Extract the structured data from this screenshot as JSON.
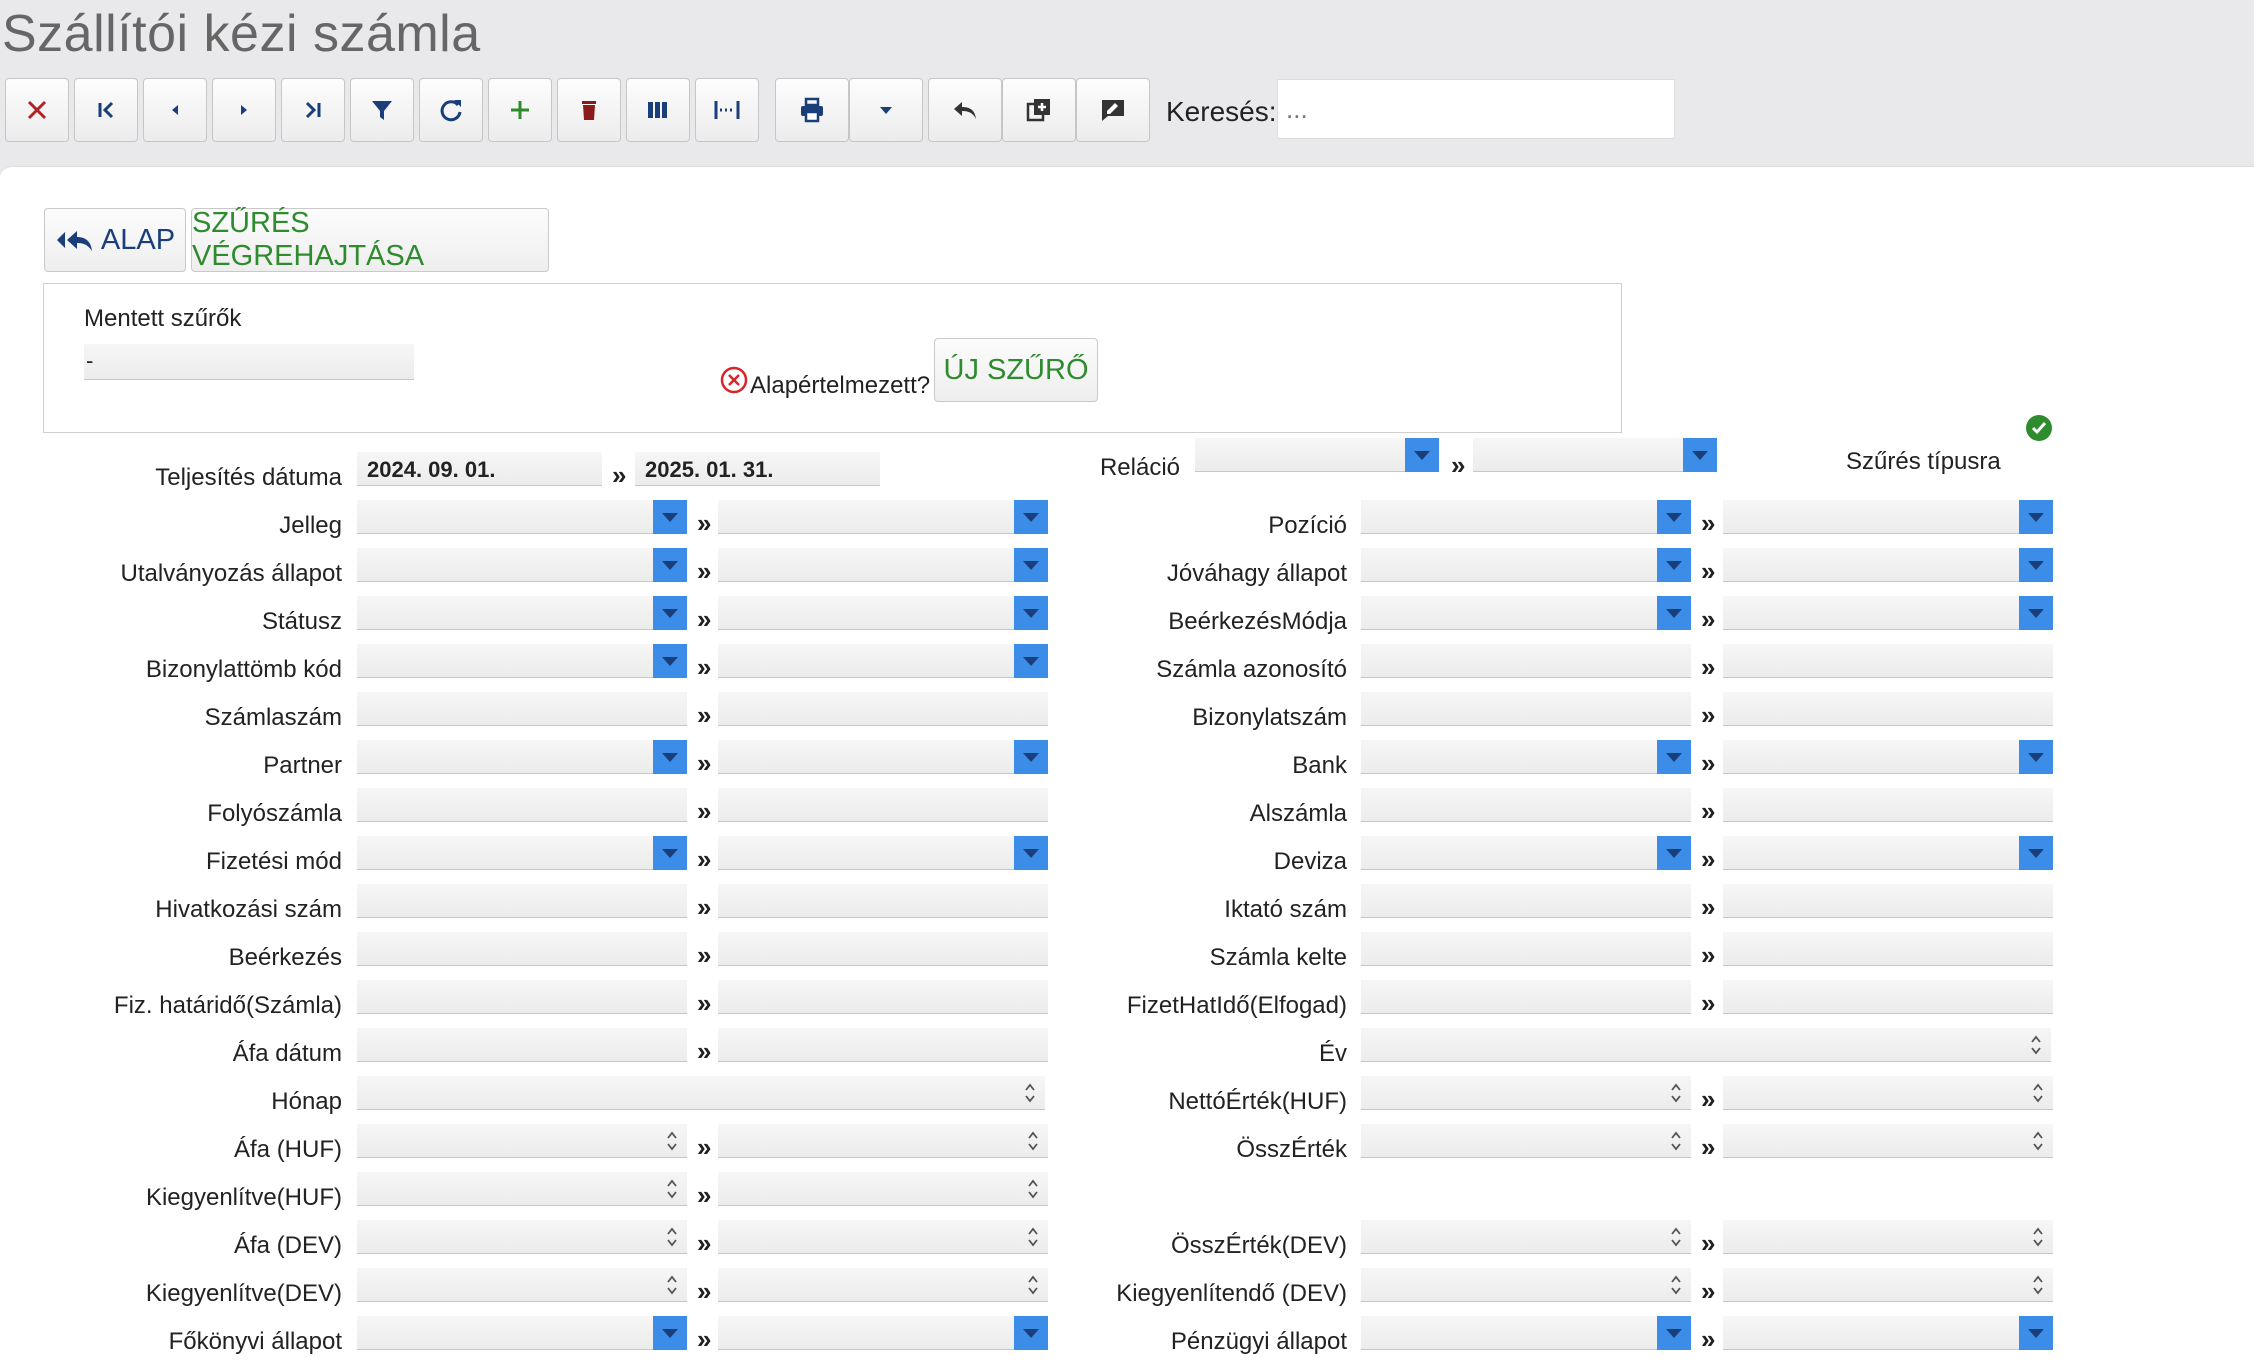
{
  "window": {
    "title": "Szállítói kézi számla"
  },
  "toolbar": {
    "buttons": [
      {
        "name": "close-button",
        "icon": "close-icon"
      },
      {
        "name": "first-record-button",
        "icon": "first-icon"
      },
      {
        "name": "prev-record-button",
        "icon": "prev-icon"
      },
      {
        "name": "next-record-button",
        "icon": "next-icon"
      },
      {
        "name": "last-record-button",
        "icon": "last-icon"
      },
      {
        "name": "filter-button",
        "icon": "filter-icon"
      },
      {
        "name": "refresh-button",
        "icon": "refresh-icon"
      },
      {
        "name": "add-button",
        "icon": "plus-icon"
      },
      {
        "name": "delete-button",
        "icon": "trash-icon"
      },
      {
        "name": "columns-button",
        "icon": "columns-icon"
      },
      {
        "name": "fit-width-button",
        "icon": "width-icon"
      },
      {
        "name": "print-button",
        "icon": "printer-icon"
      },
      {
        "name": "more-dropdown-button",
        "icon": "caret-down-icon"
      },
      {
        "name": "undo-button",
        "icon": "reply-icon"
      },
      {
        "name": "copy-button",
        "icon": "duplicate-icon"
      },
      {
        "name": "note-button",
        "icon": "edit-note-icon"
      }
    ],
    "search_label": "Keresés:",
    "search_placeholder": "..."
  },
  "actions": {
    "back_label": "ALAP",
    "run_label": "SZŰRÉS VÉGREHAJTÁSA"
  },
  "saved_filters": {
    "label": "Mentett szűrők",
    "value": "-",
    "default_label": "Alapértelmezett?",
    "new_label": "ÚJ SZŰRŐ"
  },
  "filter_type_label": "Szűrés típusra",
  "colors": {
    "accent_green": "#2e8b2e",
    "dropdown_blue": "#3b8de8",
    "delete_red": "#8b1a1a",
    "close_red": "#b22222"
  },
  "separator": "»",
  "left_fields": [
    {
      "label": "Teljesítés dátuma",
      "type": "date",
      "from": "2024. 09. 01.",
      "to": "2025. 01. 31."
    },
    {
      "label": "Jelleg",
      "type": "select"
    },
    {
      "label": "Utalványozás állapot",
      "type": "select"
    },
    {
      "label": "Státusz",
      "type": "select"
    },
    {
      "label": "Bizonylattömb kód",
      "type": "select"
    },
    {
      "label": "Számlaszám",
      "type": "text"
    },
    {
      "label": "Partner",
      "type": "select"
    },
    {
      "label": "Folyószámla",
      "type": "text"
    },
    {
      "label": "Fizetési mód",
      "type": "select"
    },
    {
      "label": "Hivatkozási szám",
      "type": "text"
    },
    {
      "label": "Beérkezés",
      "type": "text"
    },
    {
      "label": "Fiz. határidő(Számla)",
      "type": "text"
    },
    {
      "label": "Áfa dátum",
      "type": "text"
    },
    {
      "label": "Hónap",
      "type": "number-single"
    },
    {
      "label": "Áfa (HUF)",
      "type": "number"
    },
    {
      "label": "Kiegyenlítve(HUF)",
      "type": "number"
    },
    {
      "label": "Áfa (DEV)",
      "type": "number"
    },
    {
      "label": "Kiegyenlítve(DEV)",
      "type": "number"
    },
    {
      "label": "Főkönyvi állapot",
      "type": "select"
    }
  ],
  "right_fields": [
    {
      "label": "Reláció",
      "type": "select-short"
    },
    {
      "label": "Pozíció",
      "type": "select"
    },
    {
      "label": "Jóváhagy állapot",
      "type": "select"
    },
    {
      "label": "BeérkezésMódja",
      "type": "select"
    },
    {
      "label": "Számla azonosító",
      "type": "text"
    },
    {
      "label": "Bizonylatszám",
      "type": "text"
    },
    {
      "label": "Bank",
      "type": "select"
    },
    {
      "label": "Alszámla",
      "type": "text"
    },
    {
      "label": "Deviza",
      "type": "select"
    },
    {
      "label": "Iktató szám",
      "type": "text"
    },
    {
      "label": "Számla kelte",
      "type": "text"
    },
    {
      "label": "FizetHatIdő(Elfogad)",
      "type": "text"
    },
    {
      "label": "Év",
      "type": "number-single"
    },
    {
      "label": "NettóÉrték(HUF)",
      "type": "number"
    },
    {
      "label": "ÖsszÉrték",
      "type": "number"
    },
    {
      "label": "",
      "type": "empty"
    },
    {
      "label": "ÖsszÉrték(DEV)",
      "type": "number"
    },
    {
      "label": "Kiegyenlítendő (DEV)",
      "type": "number"
    },
    {
      "label": "Pénzügyi állapot",
      "type": "select"
    }
  ]
}
